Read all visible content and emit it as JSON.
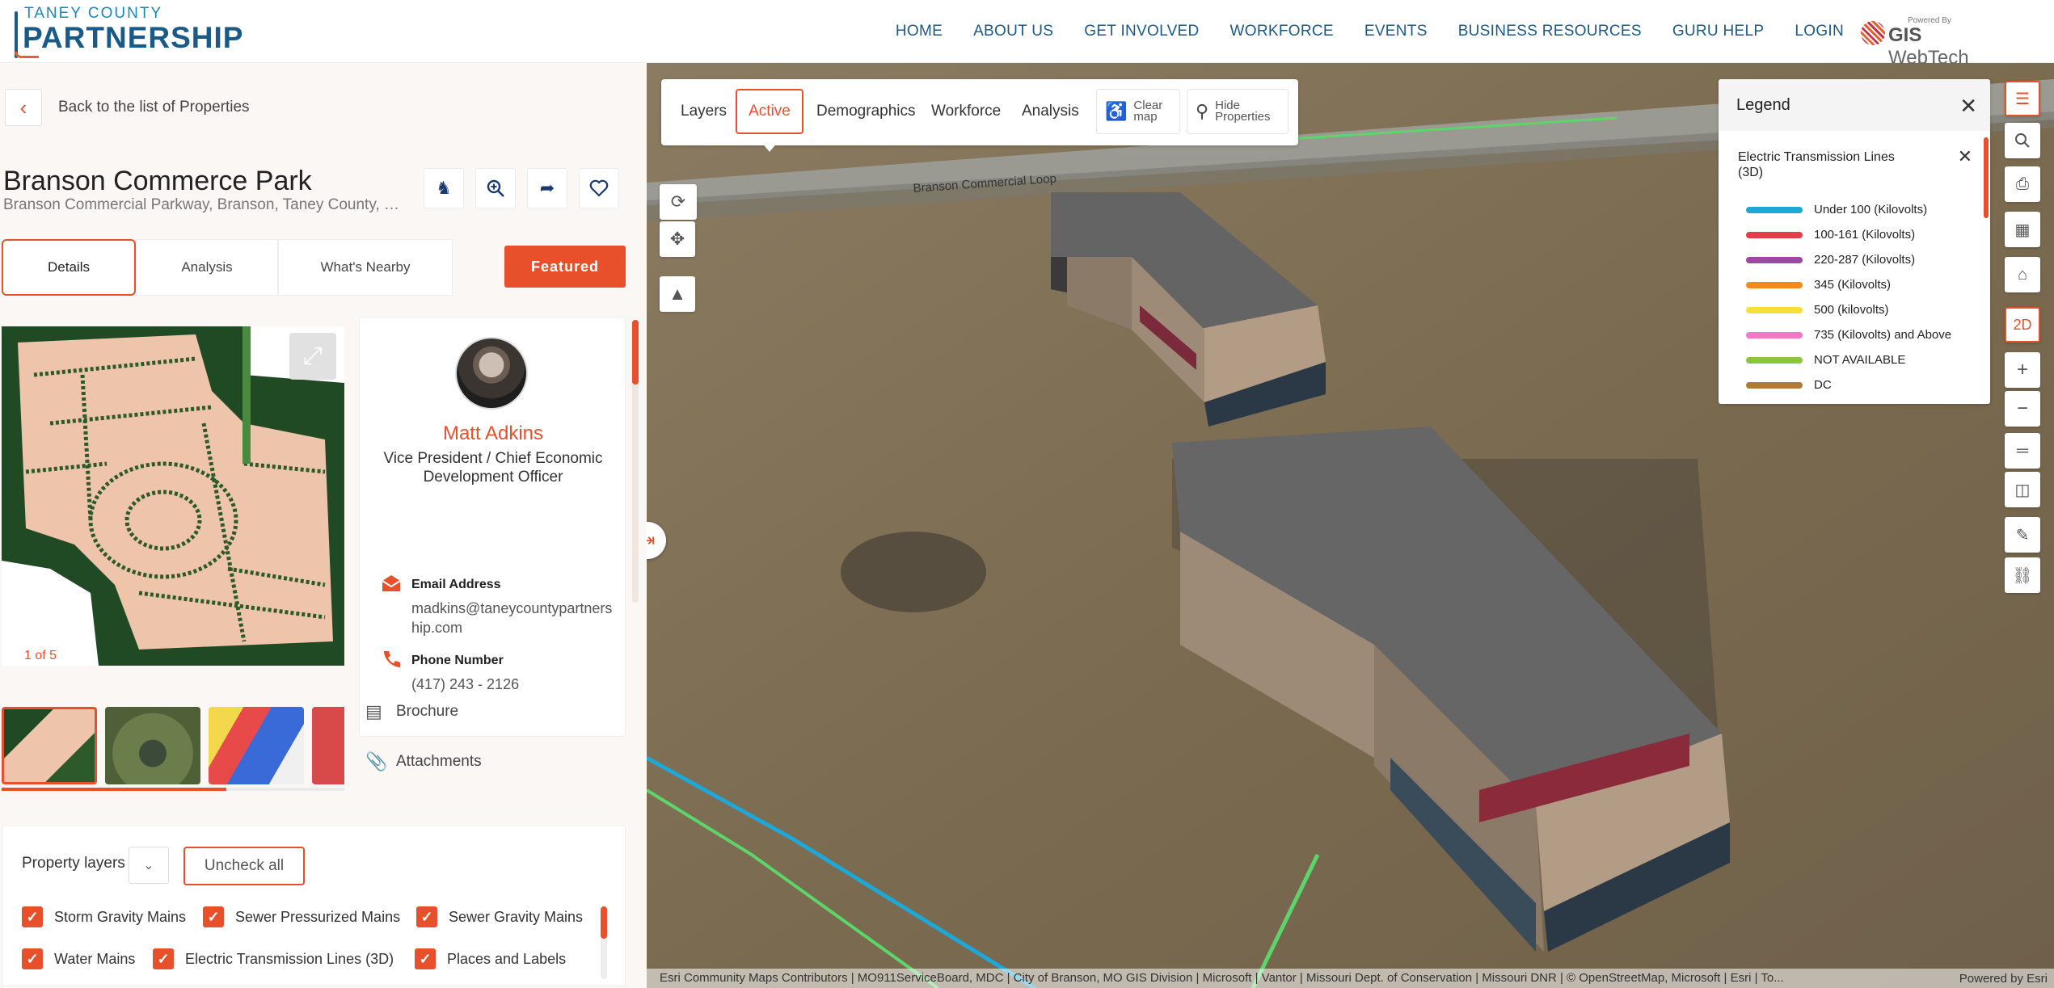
{
  "logo": {
    "line1": "TANEY COUNTY",
    "line2": "PARTNERSHIP"
  },
  "nav": [
    "HOME",
    "ABOUT US",
    "GET INVOLVED",
    "WORKFORCE",
    "EVENTS",
    "BUSINESS RESOURCES",
    "GURU HELP",
    "LOGIN"
  ],
  "gis": {
    "powered": "Powered By",
    "brand": "GIS",
    "brand2": "WebTech"
  },
  "back_label": "Back to the list of Properties",
  "property": {
    "title": "Branson Commerce Park",
    "subtitle": "Branson Commercial Parkway, Branson, Taney County, Mi..."
  },
  "tabs": [
    "Details",
    "Analysis",
    "What's Nearby"
  ],
  "featured": "Featured",
  "image_count": "1 of 5",
  "contact": {
    "name": "Matt Adkins",
    "role": "Vice President / Chief Economic Development Officer",
    "email_label": "Email Address",
    "email": "madkins@taneycountypartnership.com",
    "phone_label": "Phone Number",
    "phone": "(417) 243 - 2126"
  },
  "links": {
    "brochure": "Brochure",
    "attachments": "Attachments"
  },
  "property_layers": {
    "label": "Property layers",
    "uncheck": "Uncheck all",
    "items": [
      "Storm Gravity Mains",
      "Sewer Pressurized Mains",
      "Sewer Gravity Mains",
      "Water Mains",
      "Electric Transmission Lines (3D)",
      "Places and Labels"
    ]
  },
  "map_tabs": {
    "layers": "Layers",
    "active": "Active",
    "demographics": "Demographics",
    "workforce": "Workforce",
    "analysis": "Analysis",
    "clear": "Clear map",
    "hide": "Hide Properties"
  },
  "legend": {
    "title": "Legend",
    "subtitle": "Electric Transmission Lines (3D)",
    "items": [
      {
        "label": "Under 100 (Kilovolts)",
        "color": "#1ea8d8"
      },
      {
        "label": "100-161 (Kilovolts)",
        "color": "#e0404a"
      },
      {
        "label": "220-287 (Kilovolts)",
        "color": "#9b4aa0"
      },
      {
        "label": "345 (Kilovolts)",
        "color": "#f28a1e"
      },
      {
        "label": "500 (kilovolts)",
        "color": "#f7e03a"
      },
      {
        "label": "735 (Kilovolts) and Above",
        "color": "#f07ac8"
      },
      {
        "label": "NOT AVAILABLE",
        "color": "#8cc63f"
      },
      {
        "label": "DC",
        "color": "#b07a3a"
      }
    ]
  },
  "right_tools": {
    "twod": "2D"
  },
  "attribution": "Esri Community Maps Contributors | MO911ServiceBoard, MDC | City of Branson, MO GIS Division | Microsoft | Vantor | Missouri Dept. of Conservation | Missouri DNR | © OpenStreetMap, Microsoft | Esri | To...",
  "powered_by": "Powered by Esri",
  "road_label": "Branson Commercial Loop"
}
